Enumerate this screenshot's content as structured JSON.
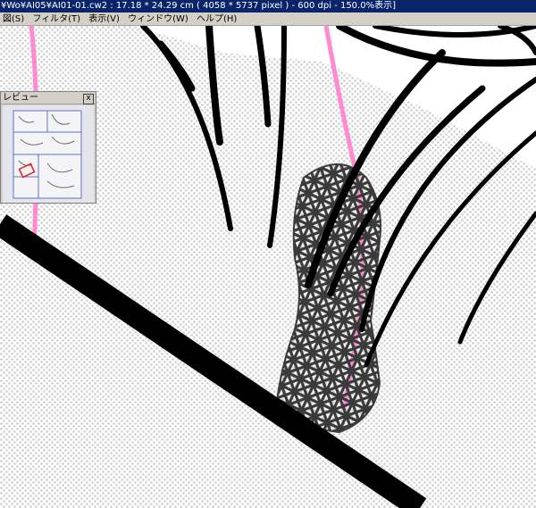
{
  "window": {
    "title": "¥Wo¥AI05¥AI01-01.cw2 :  17.18 * 24.29 cm ( 4058 * 5737 pixel ) - 600 dpi - 150.0%表示]"
  },
  "menu": {
    "items": [
      {
        "name": "menu-edit",
        "label": "図(S)"
      },
      {
        "name": "menu-filter",
        "label": "フィルタ(T)"
      },
      {
        "name": "menu-view",
        "label": "表示(V)"
      },
      {
        "name": "menu-window",
        "label": "ウィンドウ(W)"
      },
      {
        "name": "menu-help",
        "label": "ヘルプ(H)"
      }
    ]
  },
  "preview_panel": {
    "title": "レビュー",
    "close_label": "x"
  },
  "colors": {
    "titlebar": "#0a246a",
    "menubar": "#d4d0c8",
    "pink_guide": "#ff8ad2",
    "ink": "#000000",
    "tone_dot": "#d3d3d3",
    "scribble": "#3a3a3a",
    "preview_frame": "#6070c8",
    "preview_selection": "#e02020"
  }
}
